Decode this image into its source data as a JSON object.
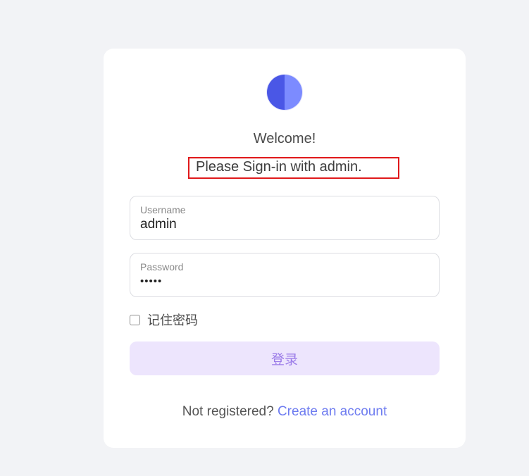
{
  "login": {
    "welcome": "Welcome!",
    "subtitle": "Please Sign-in with admin.",
    "username": {
      "label": "Username",
      "value": "admin"
    },
    "password": {
      "label": "Password",
      "masked_value": "•••••"
    },
    "remember_label": "记住密码",
    "remember_checked": false,
    "submit_label": "登录",
    "register_prompt": "Not registered?",
    "register_link": "Create an account"
  },
  "colors": {
    "background": "#f2f3f6",
    "card": "#ffffff",
    "logo_left": "#4a57e6",
    "logo_right": "#7c8bff",
    "button_bg": "#ede5fd",
    "button_text": "#9b7be8",
    "link": "#6e7cf0",
    "highlight_box": "#e0191b"
  }
}
